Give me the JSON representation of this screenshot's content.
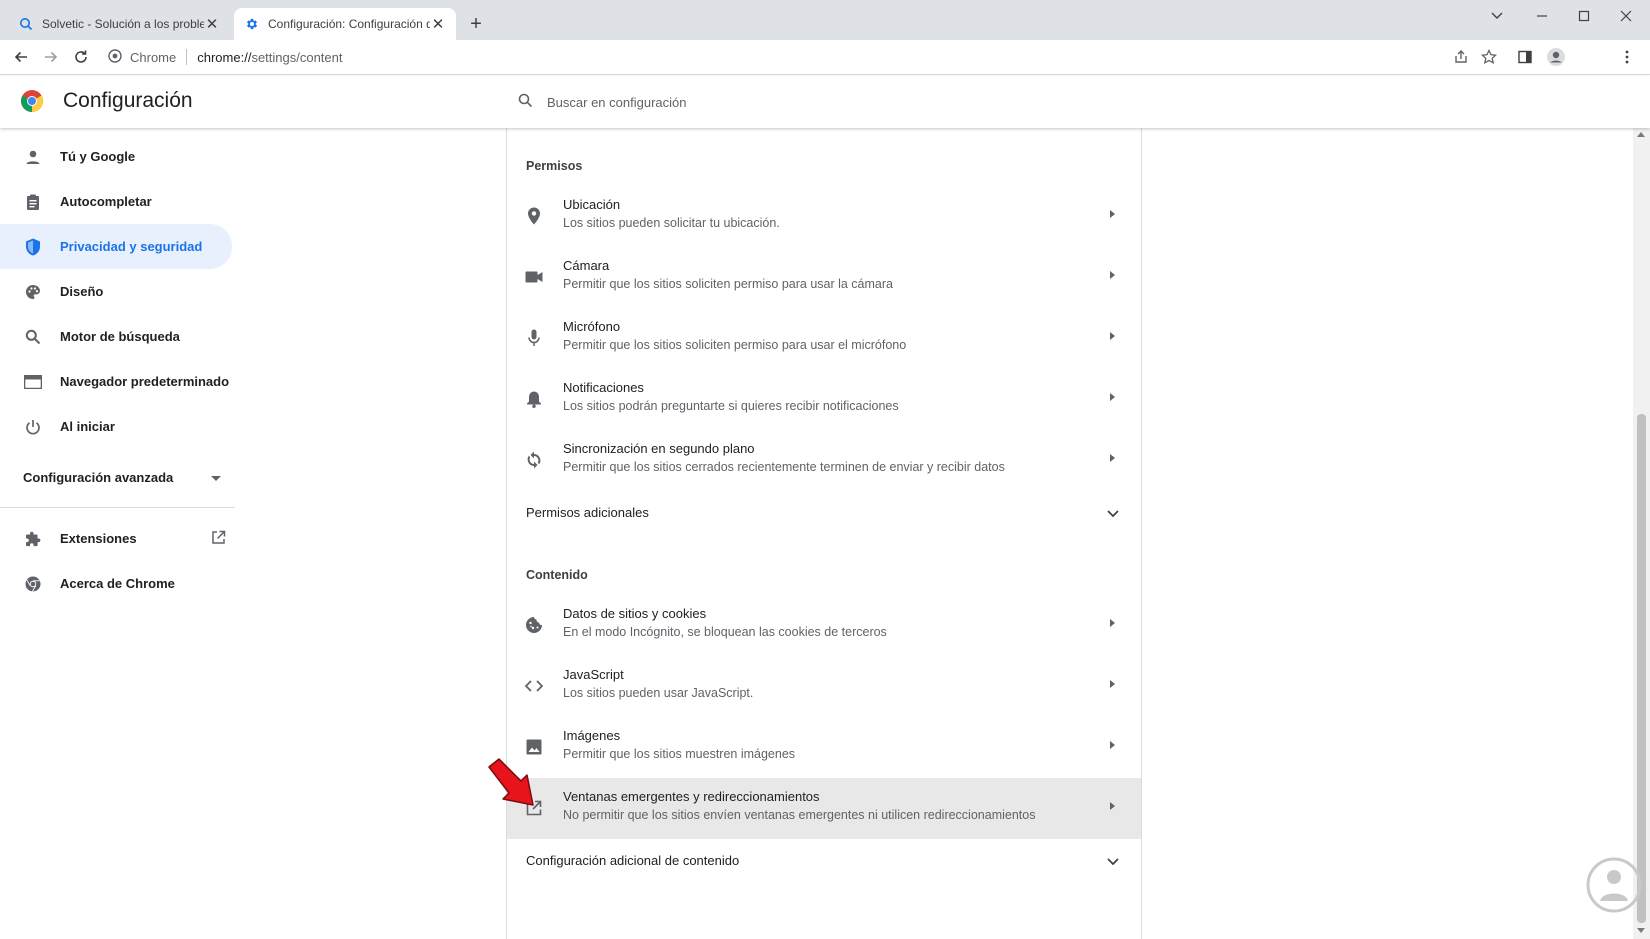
{
  "tabs": [
    {
      "title": "Solvetic - Solución a los problemas",
      "active": false
    },
    {
      "title": "Configuración: Configuración de",
      "active": true
    }
  ],
  "omnibox": {
    "origin": "Chrome",
    "url_host": "chrome://",
    "url_path": "settings/content"
  },
  "header": {
    "title": "Configuración",
    "search_placeholder": "Buscar en configuración"
  },
  "nav": {
    "items": [
      {
        "label": "Tú y Google",
        "icon": "person-icon",
        "selected": false
      },
      {
        "label": "Autocompletar",
        "icon": "clipboard-icon",
        "selected": false
      },
      {
        "label": "Privacidad y seguridad",
        "icon": "shield-icon",
        "selected": true
      },
      {
        "label": "Diseño",
        "icon": "palette-icon",
        "selected": false
      },
      {
        "label": "Motor de búsqueda",
        "icon": "search-icon",
        "selected": false
      },
      {
        "label": "Navegador predeterminado",
        "icon": "browser-icon",
        "selected": false
      },
      {
        "label": "Al iniciar",
        "icon": "power-icon",
        "selected": false
      }
    ],
    "advanced": "Configuración avanzada",
    "extensions": "Extensiones",
    "about": "Acerca de Chrome"
  },
  "permissions": {
    "title": "Permisos",
    "rows": [
      {
        "title": "Ubicación",
        "subtitle": "Los sitios pueden solicitar tu ubicación.",
        "icon": "location-pin-icon"
      },
      {
        "title": "Cámara",
        "subtitle": "Permitir que los sitios soliciten permiso para usar la cámara",
        "icon": "camera-icon"
      },
      {
        "title": "Micrófono",
        "subtitle": "Permitir que los sitios soliciten permiso para usar el micrófono",
        "icon": "microphone-icon"
      },
      {
        "title": "Notificaciones",
        "subtitle": "Los sitios podrán preguntarte si quieres recibir notificaciones",
        "icon": "bell-icon"
      },
      {
        "title": "Sincronización en segundo plano",
        "subtitle": "Permitir que los sitios cerrados recientemente terminen de enviar y recibir datos",
        "icon": "sync-icon"
      }
    ],
    "additional": "Permisos adicionales"
  },
  "content": {
    "title": "Contenido",
    "rows": [
      {
        "title": "Datos de sitios y cookies",
        "subtitle": "En el modo Incógnito, se bloquean las cookies de terceros",
        "icon": "cookie-icon"
      },
      {
        "title": "JavaScript",
        "subtitle": "Los sitios pueden usar JavaScript.",
        "icon": "code-icon"
      },
      {
        "title": "Imágenes",
        "subtitle": "Permitir que los sitios muestren imágenes",
        "icon": "image-icon"
      },
      {
        "title": "Ventanas emergentes y redireccionamientos",
        "subtitle": "No permitir que los sitios envíen ventanas emergentes ni utilicen redireccionamientos",
        "icon": "open-in-new-icon",
        "highlighted": true
      }
    ],
    "additional": "Configuración adicional de contenido"
  },
  "colors": {
    "accent": "#1a73e8",
    "selected_bg": "#e8f0fe",
    "highlight_row": "#e8e8e8",
    "annotation_arrow": "#e8141b"
  }
}
